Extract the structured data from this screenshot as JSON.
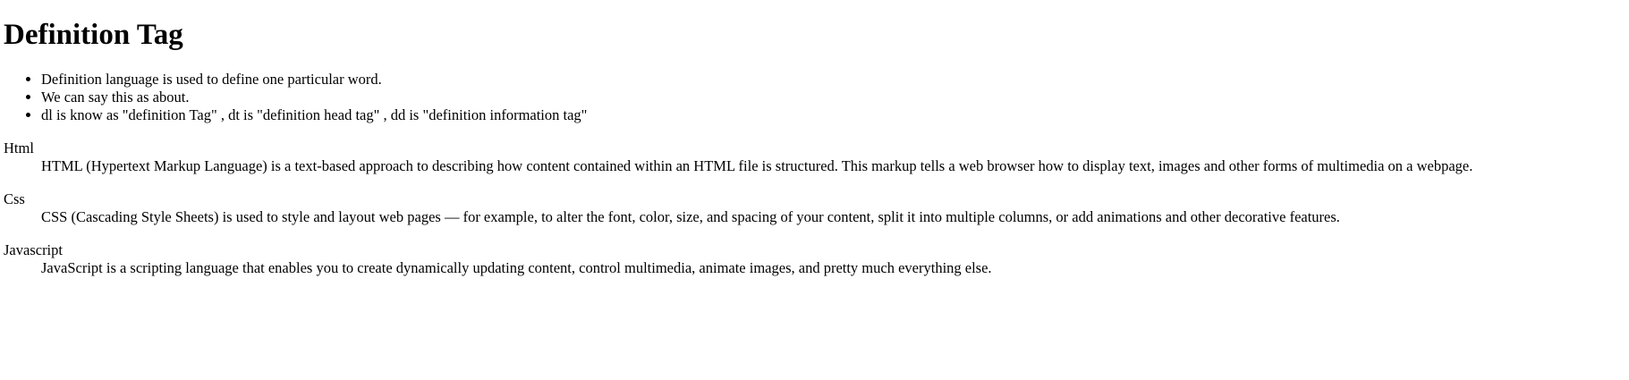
{
  "heading": "Definition Tag",
  "bullets": [
    "Definition language is used to define one particular word.",
    "We can say this as about.",
    "dl is know as \"definition Tag\" , dt is \"definition head tag\" , dd is \"definition information tag\""
  ],
  "definitions": [
    {
      "term": "Html",
      "description": "HTML (Hypertext Markup Language) is a text-based approach to describing how content contained within an HTML file is structured. This markup tells a web browser how to display text, images and other forms of multimedia on a webpage."
    },
    {
      "term": "Css",
      "description": "CSS (Cascading Style Sheets) is used to style and layout web pages — for example, to alter the font, color, size, and spacing of your content, split it into multiple columns, or add animations and other decorative features."
    },
    {
      "term": "Javascript",
      "description": "JavaScript is a scripting language that enables you to create dynamically updating content, control multimedia, animate images, and pretty much everything else."
    }
  ]
}
